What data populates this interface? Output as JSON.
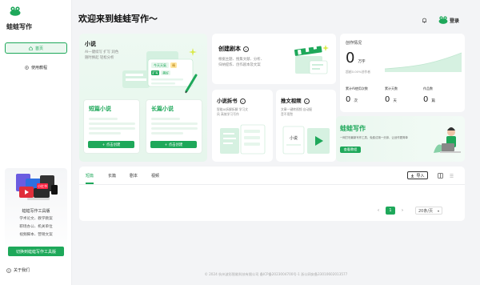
{
  "sidebar": {
    "brand": "蛙蛙写作",
    "nav": [
      {
        "label": "首页",
        "icon": "home-icon",
        "active": true
      },
      {
        "label": "使用教程",
        "icon": "compass-icon",
        "active": false
      }
    ],
    "tool_card": {
      "badge": "小红书",
      "title": "蛙蛙写作工具版",
      "lines": [
        "学术论文、教学教案",
        "职场办公、机关单位",
        "视频脚本、营销文案"
      ],
      "button": "切换到蛙蛙写作工具版"
    },
    "about": "关于我们"
  },
  "header": {
    "welcome": "欢迎来到蛙蛙写作～",
    "login": "登录"
  },
  "novel": {
    "title": "小说",
    "desc": [
      "AI一键续写 扩写 润色",
      "随时换起 轻松分析"
    ],
    "illus_tags": [
      "今天天氣",
      "扩写",
      "美好",
      "晴"
    ],
    "short": {
      "title": "短篇小说",
      "button": "+ 点击创建"
    },
    "long": {
      "title": "长篇小说",
      "button": "+ 点击创建"
    }
  },
  "script": {
    "title": "创建剧本",
    "desc": [
      "根据主题、搜集文献、分析、",
      "归纳提炼、创作剧本及文案"
    ]
  },
  "split": {
    "title": "小说拆书",
    "desc": [
      "智能AI拆解拆解 学习文",
      "风 高效学习写作"
    ]
  },
  "video": {
    "title": "推文视频",
    "desc": [
      "文章一键转视频 自动配",
      "音不用愁"
    ],
    "illus_label": "小说"
  },
  "stats": {
    "title": "创作情况",
    "total_value": "0",
    "total_unit": "万字",
    "note": "超越0.00%创作者",
    "items": [
      {
        "label": "累计AI使用次数",
        "value": "0",
        "unit": "次"
      },
      {
        "label": "累计天数",
        "value": "0",
        "unit": "天"
      },
      {
        "label": "作品数",
        "value": "0",
        "unit": "篇"
      }
    ]
  },
  "promo": {
    "title": "蛙蛙写作",
    "desc": "一网打尽最新写作工具，免费试用一分钟，让创作更简单",
    "button": "查看教程"
  },
  "tabs": {
    "items": [
      "短篇",
      "长篇",
      "剧本",
      "视频"
    ],
    "active_index": 0,
    "import": "导入"
  },
  "pager": {
    "current": "1",
    "page_size": "20条/页"
  },
  "footer": "© 2024 杭州波形智能科技有限公司 备ICP备2023004700号-1     浙公网安备33010602013577",
  "colors": {
    "accent": "#1ea85a",
    "accent_light": "#eaf7ef"
  }
}
